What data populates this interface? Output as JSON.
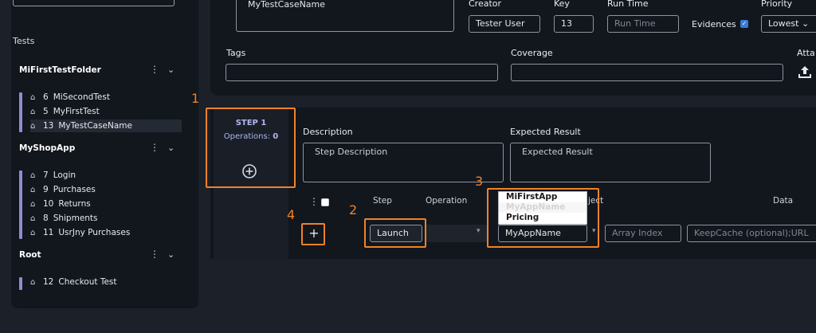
{
  "sidebar": {
    "title": "Tests",
    "folders": [
      {
        "name": "MiFirstTestFolder",
        "items": [
          {
            "num": "6",
            "label": "MiSecondTest"
          },
          {
            "num": "5",
            "label": "MyFirstTest"
          },
          {
            "num": "13",
            "label": "MyTestCaseName"
          }
        ]
      },
      {
        "name": "MyShopApp",
        "items": [
          {
            "num": "7",
            "label": "Login"
          },
          {
            "num": "9",
            "label": "Purchases"
          },
          {
            "num": "10",
            "label": "Returns"
          },
          {
            "num": "8",
            "label": "Shipments"
          },
          {
            "num": "11",
            "label": "UsrJny Purchases"
          }
        ]
      },
      {
        "name": "Root",
        "items": [
          {
            "num": "12",
            "label": "Checkout Test"
          }
        ]
      }
    ]
  },
  "testcase": {
    "name_value": "MyTestCaseName",
    "creator_label": "Creator",
    "creator_value": "Tester User",
    "key_label": "Key",
    "key_value": "13",
    "runtime_label": "Run Time",
    "runtime_placeholder": "Run Time",
    "evidences_label": "Evidences",
    "priority_label": "Priority",
    "priority_value": "Lowest",
    "tags_label": "Tags",
    "coverage_label": "Coverage",
    "attachments_label": "Atta"
  },
  "step": {
    "title": "STEP 1",
    "operations_label": "Operations:",
    "operations_count": "0",
    "description_label": "Description",
    "description_value": "Step Description",
    "expected_label": "Expected Result",
    "expected_value": "Expected Result",
    "columns": {
      "step": "Step",
      "operation": "Operation",
      "object": "ject",
      "data": "Data"
    },
    "step_value": "Launch",
    "object_value": "MyAppName",
    "array_index_placeholder": "Array Index",
    "data_placeholder": "KeepCache (optional);URL",
    "dropdown_options": [
      "MiFirstApp",
      "MyAppName",
      "Pricing"
    ]
  },
  "annotations": {
    "a1": "1",
    "a2": "2",
    "a3": "3",
    "a4": "4"
  },
  "colors": {
    "accent": "#f0822a",
    "panel": "#12161d",
    "background": "#1b2029",
    "tree_bar": "#8d8ed0"
  }
}
